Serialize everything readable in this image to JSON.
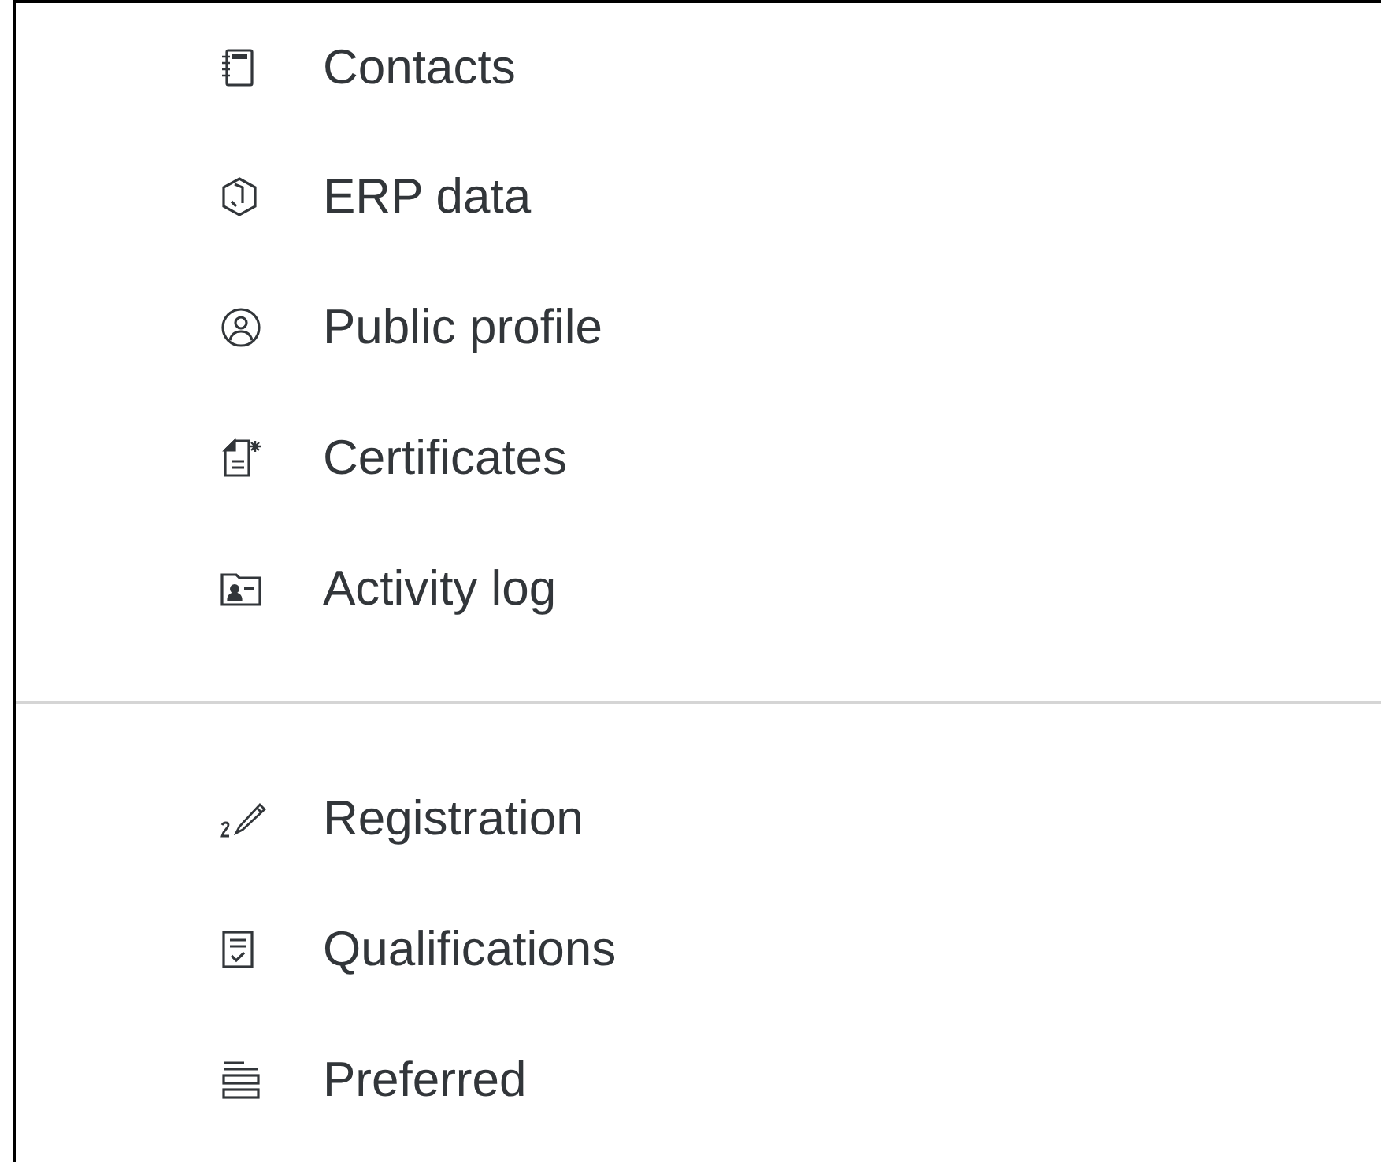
{
  "menu": {
    "groups": [
      {
        "items": [
          {
            "label": "Contacts",
            "kind": "notebook"
          },
          {
            "label": "ERP data",
            "kind": "cube"
          },
          {
            "label": "Public profile",
            "kind": "person"
          },
          {
            "label": "Certificates",
            "kind": "certificate"
          },
          {
            "label": "Activity log",
            "kind": "folder"
          }
        ]
      },
      {
        "items": [
          {
            "label": "Registration",
            "kind": "pencil"
          },
          {
            "label": "Qualifications",
            "kind": "checklist"
          },
          {
            "label": "Preferred",
            "kind": "bars"
          }
        ]
      }
    ]
  }
}
